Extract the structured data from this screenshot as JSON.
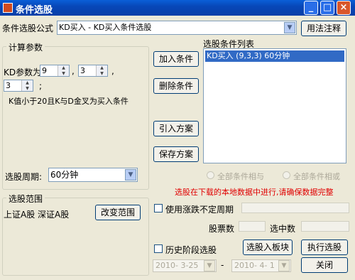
{
  "window": {
    "title": "条件选股"
  },
  "formula": {
    "label": "条件选股公式",
    "selected": "KD买入   - KD买入条件选股",
    "help_button": "用法注释"
  },
  "params": {
    "legend": "计算参数",
    "line1_prefix": "KD参数为",
    "p1": "9",
    "comma1": ",",
    "p2": "3",
    "comma2": ",",
    "p3": "3",
    "semicolon": ";",
    "description": "K值小于20且K与D金叉为买入条件",
    "period_label": "选股周期:",
    "period_value": "60分钟"
  },
  "actions": {
    "add": "加入条件",
    "delete": "删除条件",
    "import": "引入方案",
    "save": "保存方案"
  },
  "condition_list": {
    "title": "选股条件列表",
    "items": [
      "KD买入 (9,3,3) 60分钟"
    ]
  },
  "logic": {
    "and_label": "全部条件相与",
    "or_label": "全部条件相或"
  },
  "warning": "选股在下载的本地数据中进行,请确保数据完整",
  "scope": {
    "legend": "选股范围",
    "text": "上证A股 深证A股",
    "change_button": "改变范围"
  },
  "options": {
    "unstable_period": "使用涨跌不定周期",
    "stock_count_label": "股票数",
    "selected_count_label": "选中数",
    "history": "历史阶段选股",
    "date_from": "2010- 3-25",
    "dash": "-",
    "date_to": "2010- 4- 1"
  },
  "buttons": {
    "to_block": "选股入板块",
    "execute": "执行选股",
    "close": "关闭"
  }
}
